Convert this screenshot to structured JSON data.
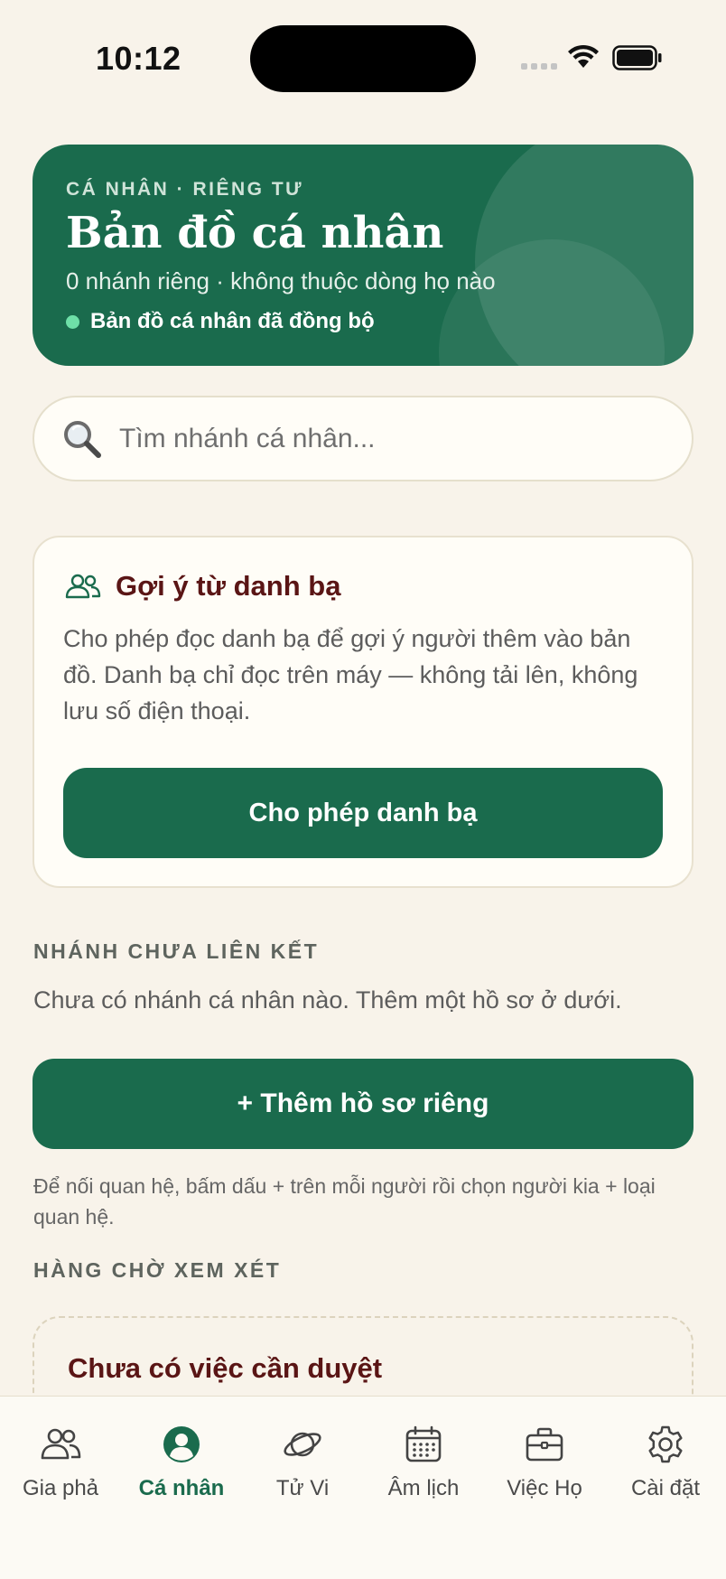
{
  "status_bar": {
    "time": "10:12"
  },
  "hero": {
    "eyebrow": "CÁ NHÂN · RIÊNG TƯ",
    "title": "Bản đồ cá nhân",
    "subtitle": "0 nhánh riêng · không thuộc dòng họ nào",
    "sync_status": "Bản đồ cá nhân đã đồng bộ",
    "accent_color": "#1a6b4d",
    "sync_dot_color": "#6ee0a8"
  },
  "search": {
    "placeholder": "Tìm nhánh cá nhân...",
    "value": "",
    "icon": "search-icon"
  },
  "contacts_card": {
    "title": "Gợi ý từ danh bạ",
    "description": "Cho phép đọc danh bạ để gợi ý người thêm vào bản đồ. Danh bạ chỉ đọc trên máy — không tải lên, không lưu số điện thoại.",
    "button_label": "Cho phép danh bạ",
    "icon": "people-icon"
  },
  "branches": {
    "section_label": "NHÁNH CHƯA LIÊN KẾT",
    "empty_text": "Chưa có nhánh cá nhân nào. Thêm một hồ sơ ở dưới.",
    "add_button_label": "+  Thêm hồ sơ riêng",
    "hint": "Để nối quan hệ, bấm dấu + trên mỗi người rồi chọn người kia + loại quan hệ."
  },
  "review": {
    "section_label": "HÀNG CHỜ XEM XÉT",
    "empty_title": "Chưa có việc cần duyệt"
  },
  "tabbar": {
    "tabs": [
      {
        "label": "Gia phả",
        "icon": "family-icon",
        "active": false
      },
      {
        "label": "Cá nhân",
        "icon": "person-circle-icon",
        "active": true
      },
      {
        "label": "Tử Vi",
        "icon": "planet-icon",
        "active": false
      },
      {
        "label": "Âm lịch",
        "icon": "calendar-icon",
        "active": false
      },
      {
        "label": "Việc Họ",
        "icon": "briefcase-icon",
        "active": false
      },
      {
        "label": "Cài đặt",
        "icon": "gear-icon",
        "active": false
      }
    ]
  }
}
